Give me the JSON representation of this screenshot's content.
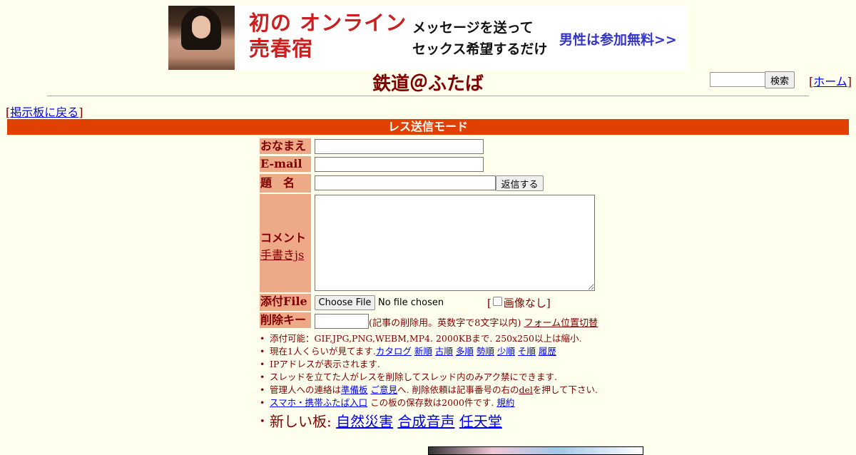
{
  "ad": {
    "title_line1": "初の オンライン",
    "title_line2": "売春宿",
    "message_line1": "メッセージを送って",
    "message_line2": "セックス希望するだけ",
    "cta": "男性は参加無料>>"
  },
  "header": {
    "board_title": "鉄道＠ふたば",
    "search_button": "検索",
    "home_link": "ホーム",
    "back_link": "掲示板に戻る"
  },
  "mode_bar": "レス送信モード",
  "form": {
    "name_label": "おなまえ",
    "email_label": "E-mail",
    "subject_label": "題　名",
    "reply_button": "返信する",
    "comment_label": "コメント",
    "handwriting_link": "手書きjs",
    "file_label": "添付File",
    "choose_file_button": "Choose File",
    "no_file_text": "No file chosen",
    "no_image_label": "画像なし",
    "delete_key_label": "削除キー",
    "delete_note": "(記事の削除用。英数字で8文字以内)",
    "form_toggle_link": "フォーム位置切替"
  },
  "info": {
    "allowed_files": "添付可能：GIF,JPG,PNG,WEBM,MP4. 2000KBまで. 250x250以上は縮小.",
    "viewers_prefix": "現在1人くらいが見てます.",
    "sort_links": [
      "カタログ",
      "新順",
      "古順",
      "多順",
      "勢順",
      "少順",
      "そ順",
      "履歴"
    ],
    "ip_shown": "IPアドレスが表示されます.",
    "thread_owner": "スレッドを立てた人がレスを削除してスレッド内のみアク禁にできます.",
    "contact_prefix": "管理人への連絡は",
    "contact_link1": "準備板",
    "contact_link2": "ご意見",
    "contact_mid": "へ. 削除依頼は記事番号の右の",
    "del_link": "del",
    "contact_suffix": "を押して下さい.",
    "mobile_link": "スマホ・携帯ふたば入口",
    "archive_text": "この板の保存数は2000件です.",
    "rules_link": "規約"
  },
  "new_boards": {
    "label": "新しい板:",
    "links": [
      "自然災害",
      "合成音声",
      "任天堂"
    ]
  }
}
